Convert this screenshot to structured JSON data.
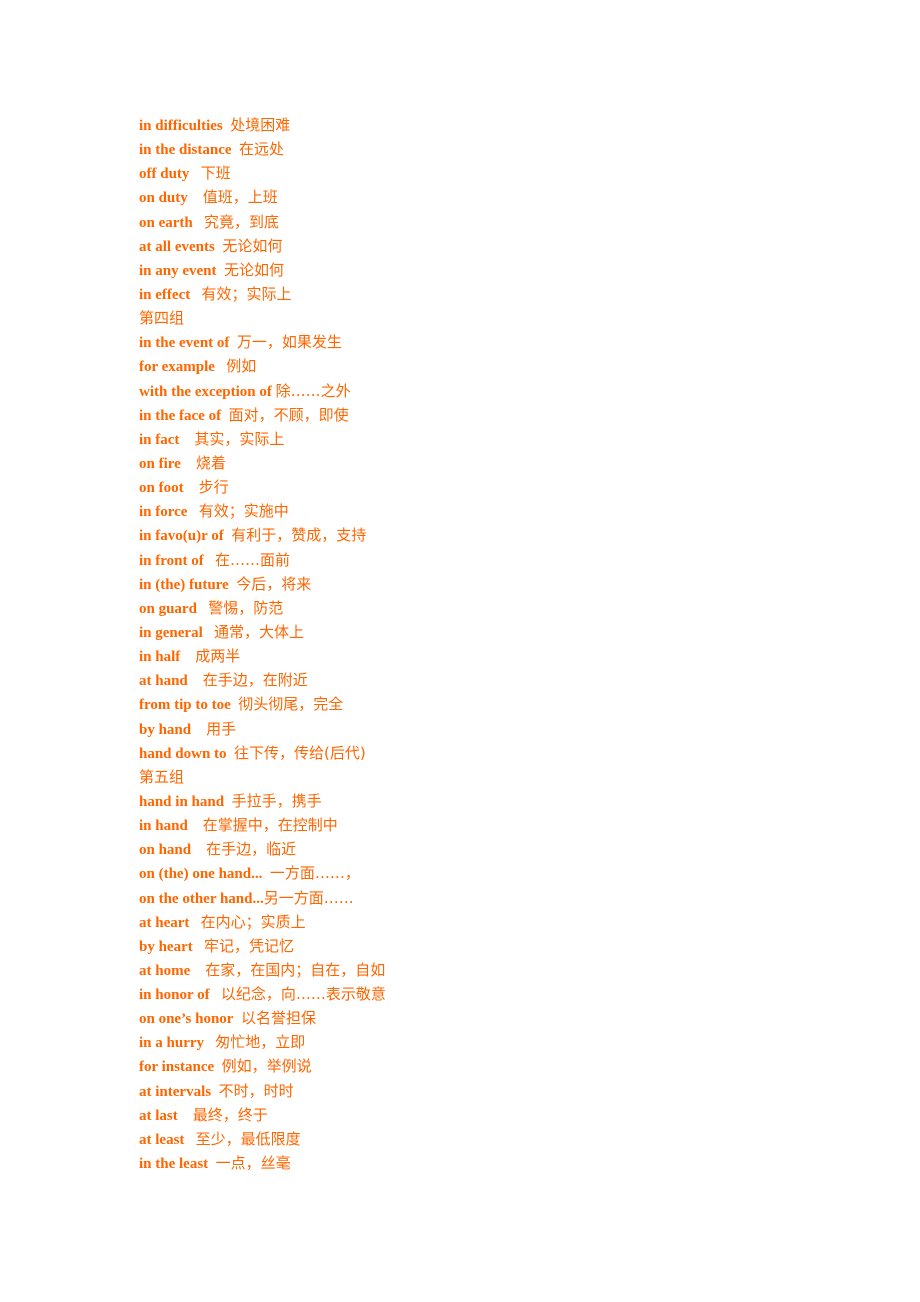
{
  "text_color": "#ff6600",
  "lines": [
    {
      "type": "entry",
      "en": "in difficulties",
      "sep": "  ",
      "zh": "处境困难"
    },
    {
      "type": "entry",
      "en": "in the distance",
      "sep": "  ",
      "zh": "在远处"
    },
    {
      "type": "entry",
      "en": "off duty",
      "sep": "   ",
      "zh": "下班"
    },
    {
      "type": "entry",
      "en": "on duty",
      "sep": "    ",
      "zh": "值班，上班"
    },
    {
      "type": "entry",
      "en": "on earth",
      "sep": "   ",
      "zh": "究竟，到底"
    },
    {
      "type": "entry",
      "en": "at all events",
      "sep": "  ",
      "zh": "无论如何"
    },
    {
      "type": "entry",
      "en": "in any event",
      "sep": "  ",
      "zh": "无论如何"
    },
    {
      "type": "entry",
      "en": "in effect",
      "sep": "   ",
      "zh": "有效；实际上"
    },
    {
      "type": "heading",
      "text": "第四组"
    },
    {
      "type": "entry",
      "en": "in the event of",
      "sep": "  ",
      "zh": "万一，如果发生"
    },
    {
      "type": "entry",
      "en": "for example",
      "sep": "   ",
      "zh": "例如"
    },
    {
      "type": "entry",
      "en": "with the exception of",
      "sep": " ",
      "zh": "除……之外"
    },
    {
      "type": "entry",
      "en": "in the face of",
      "sep": "  ",
      "zh": "面对，不顾，即使"
    },
    {
      "type": "entry",
      "en": "in fact",
      "sep": "    ",
      "zh": "其实，实际上"
    },
    {
      "type": "entry",
      "en": "on fire",
      "sep": "    ",
      "zh": "烧着"
    },
    {
      "type": "entry",
      "en": "on foot",
      "sep": "    ",
      "zh": "步行"
    },
    {
      "type": "entry",
      "en": "in force",
      "sep": "   ",
      "zh": "有效；实施中"
    },
    {
      "type": "entry",
      "en": "in favo(u)r of",
      "sep": "  ",
      "zh": "有利于，赞成，支持"
    },
    {
      "type": "entry",
      "en": "in front of",
      "sep": "   ",
      "zh": "在……面前"
    },
    {
      "type": "entry",
      "en": "in (the) future",
      "sep": "  ",
      "zh": "今后，将来"
    },
    {
      "type": "entry",
      "en": "on guard",
      "sep": "   ",
      "zh": "警惕，防范"
    },
    {
      "type": "entry",
      "en": "in general",
      "sep": "   ",
      "zh": "通常，大体上"
    },
    {
      "type": "entry",
      "en": "in half",
      "sep": "    ",
      "zh": "成两半"
    },
    {
      "type": "entry",
      "en": "at hand",
      "sep": "    ",
      "zh": "在手边，在附近"
    },
    {
      "type": "entry",
      "en": "from tip to toe",
      "sep": "  ",
      "zh": "彻头彻尾，完全"
    },
    {
      "type": "entry",
      "en": "by hand",
      "sep": "    ",
      "zh": "用手"
    },
    {
      "type": "entry",
      "en": "hand down to",
      "sep": "  ",
      "zh": "往下传，传给(后代)"
    },
    {
      "type": "heading",
      "text": "第五组"
    },
    {
      "type": "entry",
      "en": "hand in hand",
      "sep": "  ",
      "zh": "手拉手，携手"
    },
    {
      "type": "entry",
      "en": "in hand",
      "sep": "    ",
      "zh": "在掌握中，在控制中"
    },
    {
      "type": "entry",
      "en": "on hand",
      "sep": "    ",
      "zh": "在手边，临近"
    },
    {
      "type": "entry",
      "en": "on (the) one hand...",
      "sep": "  ",
      "zh": "一方面……，"
    },
    {
      "type": "entry",
      "en": "on the other hand...",
      "sep": "",
      "zh": "另一方面……"
    },
    {
      "type": "entry",
      "en": "at heart",
      "sep": "   ",
      "zh": "在内心；实质上"
    },
    {
      "type": "entry",
      "en": "by heart",
      "sep": "   ",
      "zh": "牢记，凭记忆"
    },
    {
      "type": "entry",
      "en": "at home",
      "sep": "    ",
      "zh": "在家，在国内；自在，自如"
    },
    {
      "type": "entry",
      "en": "in honor of",
      "sep": "   ",
      "zh": "以纪念，向……表示敬意"
    },
    {
      "type": "entry",
      "en": "on one’s honor",
      "sep": "  ",
      "zh": "以名誉担保"
    },
    {
      "type": "entry",
      "en": "in a hurry",
      "sep": "   ",
      "zh": "匆忙地，立即"
    },
    {
      "type": "entry",
      "en": "for instance",
      "sep": "  ",
      "zh": "例如，举例说"
    },
    {
      "type": "entry",
      "en": "at intervals",
      "sep": "  ",
      "zh": "不时，时时"
    },
    {
      "type": "entry",
      "en": "at last",
      "sep": "    ",
      "zh": "最终，终于"
    },
    {
      "type": "entry",
      "en": "at least",
      "sep": "   ",
      "zh": "至少，最低限度"
    },
    {
      "type": "entry",
      "en": "in the least",
      "sep": "  ",
      "zh": "一点，丝毫"
    }
  ]
}
